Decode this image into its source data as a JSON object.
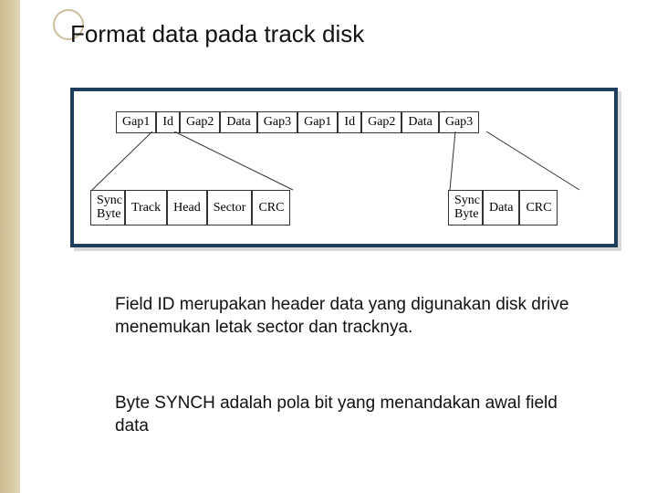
{
  "title": "Format data pada track disk",
  "seq": [
    "Gap1",
    "Id",
    "Gap2",
    "Data",
    "Gap3",
    "Gap1",
    "Id",
    "Gap2",
    "Data",
    "Gap3"
  ],
  "id_detail": [
    "Sync\nByte",
    "Track",
    "Head",
    "Sector",
    "CRC"
  ],
  "data_detail": [
    "Sync\nByte",
    "Data",
    "CRC"
  ],
  "paragraph1": "Field ID merupakan header data yang digunakan disk drive menemukan letak sector dan tracknya.",
  "paragraph2": "Byte SYNCH adalah pola bit yang menandakan awal field data"
}
